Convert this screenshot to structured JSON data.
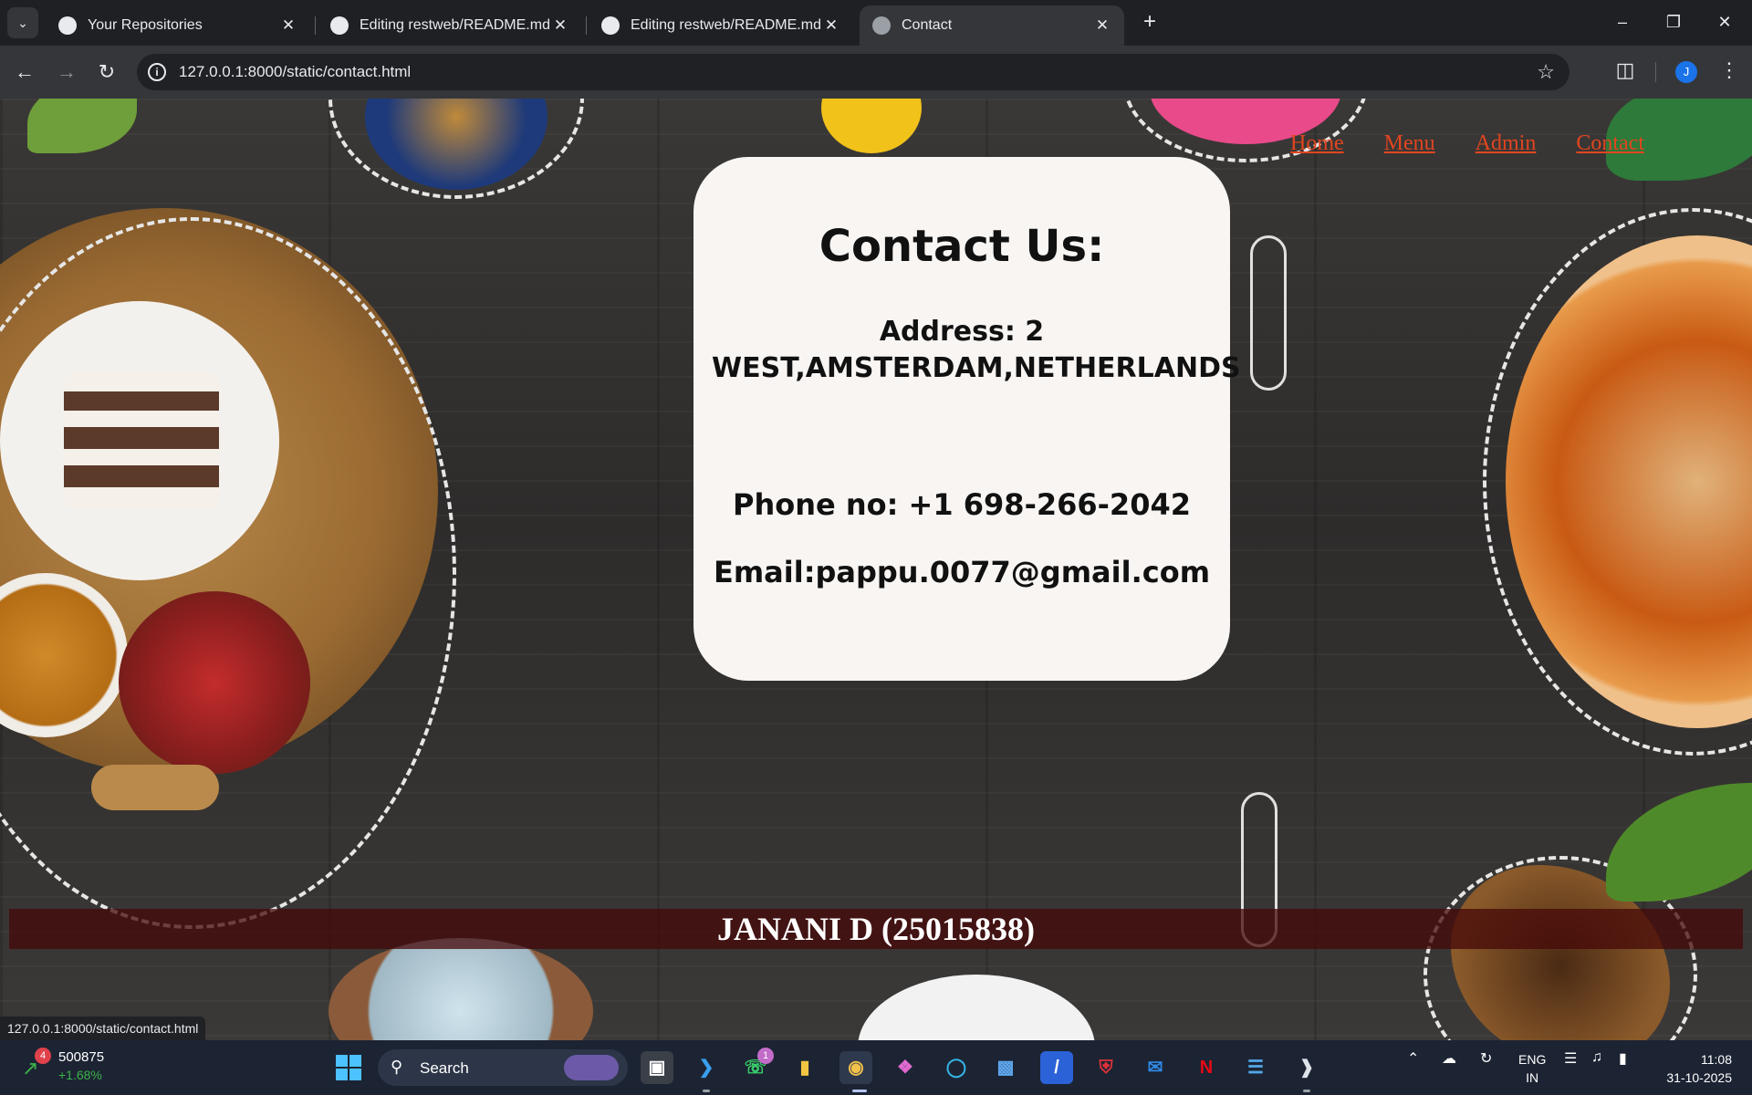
{
  "browser": {
    "tabs": [
      {
        "title": "Your Repositories",
        "active": false
      },
      {
        "title": "Editing restweb/README.md at",
        "active": false
      },
      {
        "title": "Editing restweb/README.md at",
        "active": false
      },
      {
        "title": "Contact",
        "active": true
      }
    ],
    "url": "127.0.0.1:8000/static/contact.html",
    "profile_initial": "J",
    "status_url": "127.0.0.1:8000/static/contact.html"
  },
  "page": {
    "nav": [
      "Home",
      "Menu",
      "Admin",
      "Contact"
    ],
    "contact": {
      "heading": "Contact Us:",
      "address": "Address: 2 WEST,AMSTERDAM,NETHERLANDS",
      "phone": "Phone no: +1 698-266-2042",
      "email": "Email:pappu.0077@gmail.com"
    },
    "footer": "JANANI D (25015838)",
    "colors": {
      "nav_link": "#e2451f",
      "card_bg": "#f8f5f3",
      "footer_bar": "#460808"
    }
  },
  "taskbar": {
    "stock": {
      "badge": "4",
      "value": "500875",
      "change": "+1.68%"
    },
    "search_label": "Search",
    "whatsapp_badge": "1",
    "lang": {
      "line1": "ENG",
      "line2": "IN"
    },
    "clock": {
      "time": "11:08",
      "date": "31-10-2025"
    }
  }
}
